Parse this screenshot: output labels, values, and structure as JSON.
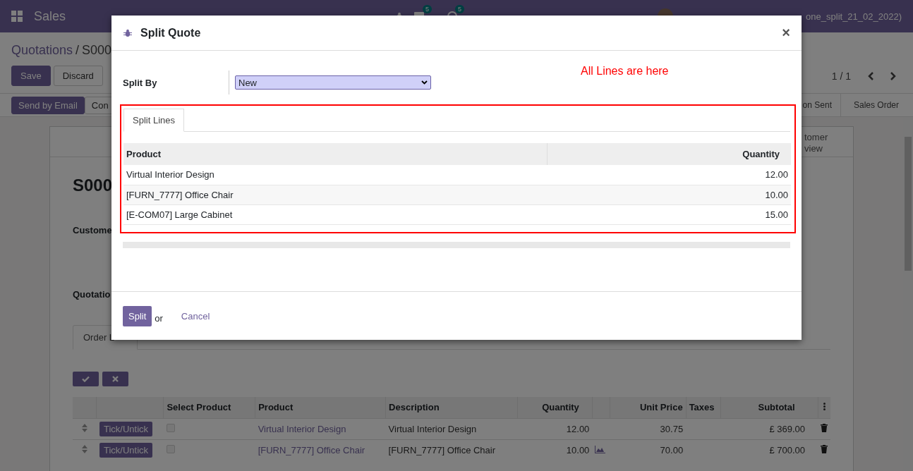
{
  "navbar": {
    "app": "Sales",
    "badges": [
      "5",
      "5"
    ],
    "user": "one_split_21_02_2022)"
  },
  "breadcrumb": {
    "parent": "Quotations",
    "separator": "/",
    "current": "S000"
  },
  "form_buttons": [
    {
      "label": "Save",
      "kind": "primary"
    },
    {
      "label": "Discard",
      "kind": "secondary"
    }
  ],
  "pager": "1 / 1",
  "status_actions": [
    {
      "label": "Send by Email",
      "kind": "primary"
    },
    {
      "label": "Con",
      "kind": "secondary"
    }
  ],
  "stages": [
    {
      "label": "on Sent",
      "selected": false
    },
    {
      "label": "Sales Order",
      "selected": false
    }
  ],
  "sheet": {
    "stat_button": "tomer view",
    "title": "S000",
    "fields": [
      "Custome",
      "Quotatio"
    ],
    "tabs": [
      {
        "label": "Order L",
        "selected": true
      }
    ],
    "columns": [
      "Select Product",
      "Product",
      "Description",
      "Quantity",
      "Unit Price",
      "Taxes",
      "Subtotal"
    ],
    "rows": [
      {
        "button": "Tick/Untick",
        "checked": false,
        "product": "Virtual Interior Design",
        "description": "Virtual Interior Design",
        "quantity": "12.00",
        "forecast": false,
        "unit_price": "30.75",
        "subtotal": "£ 369.00"
      },
      {
        "button": "Tick/Untick",
        "checked": false,
        "product": "[FURN_7777] Office Chair",
        "description": "[FURN_7777] Office Chair",
        "quantity": "10.00",
        "forecast": true,
        "unit_price": "70.00",
        "subtotal": "£ 700.00"
      }
    ]
  },
  "dialog": {
    "title": "Split Quote",
    "close": "×",
    "split_by": {
      "label": "Split By",
      "value": "New"
    },
    "note": "All Lines are here",
    "tabs": [
      {
        "label": "Split Lines",
        "selected": true
      }
    ],
    "columns": [
      "Product",
      "Quantity"
    ],
    "rows": [
      {
        "product": "Virtual Interior Design",
        "quantity": "12.00"
      },
      {
        "product": "[FURN_7777] Office Chair",
        "quantity": "10.00"
      },
      {
        "product": "[E-COM07] Large Cabinet",
        "quantity": "15.00"
      }
    ],
    "footer": {
      "primary": "Split",
      "or": "or",
      "cancel": "Cancel"
    }
  }
}
